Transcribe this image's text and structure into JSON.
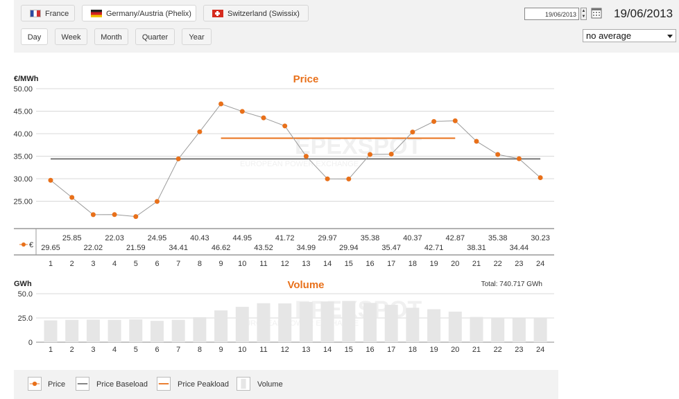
{
  "markets": [
    {
      "label": "France",
      "flag": "france-flag-icon",
      "active": false
    },
    {
      "label": "Germany/Austria (Phelix)",
      "flag": "germany-flag-icon",
      "active": true
    },
    {
      "label": "Switzerland (Swissix)",
      "flag": "switzerland-flag-icon",
      "active": false
    }
  ],
  "periods": [
    {
      "label": "Day",
      "active": true
    },
    {
      "label": "Week",
      "active": false
    },
    {
      "label": "Month",
      "active": false
    },
    {
      "label": "Quarter",
      "active": false
    },
    {
      "label": "Year",
      "active": false
    }
  ],
  "date_input": "19/06/2013",
  "date_display": "19/06/2013",
  "average_select": "no average",
  "watermark": {
    "main": "EPEXSPOT",
    "sub": "EUROPEAN POWER EXCHANGE"
  },
  "colors": {
    "price": "#e8701a",
    "baseload": "#777777",
    "peakload": "#e8701a",
    "volume": "#e6e6e6",
    "title": "#e8701a"
  },
  "chart_data": [
    {
      "type": "line",
      "title": "Price",
      "ylabel": "€/MWh",
      "ylim": [
        20,
        50
      ],
      "yticks": [
        "50.00",
        "45.00",
        "40.00",
        "35.00",
        "30.00",
        "25.00"
      ],
      "x": [
        1,
        2,
        3,
        4,
        5,
        6,
        7,
        8,
        9,
        10,
        11,
        12,
        13,
        14,
        15,
        16,
        17,
        18,
        19,
        20,
        21,
        22,
        23,
        24
      ],
      "series": [
        {
          "name": "€",
          "values": [
            29.65,
            25.85,
            22.02,
            22.03,
            21.59,
            24.95,
            34.41,
            40.43,
            46.62,
            44.95,
            43.52,
            41.72,
            34.99,
            29.97,
            29.94,
            35.38,
            35.47,
            40.37,
            42.71,
            42.87,
            38.31,
            35.38,
            34.44,
            30.23
          ]
        }
      ],
      "baseload": 34.4,
      "peakload": {
        "value": 39.0,
        "from": 9,
        "to": 20
      },
      "table_labels": [
        "29.65",
        "25.85",
        "22.02",
        "22.03",
        "21.59",
        "24.95",
        "34.41",
        "40.43",
        "46.62",
        "44.95",
        "43.52",
        "41.72",
        "34.99",
        "29.97",
        "29.94",
        "35.38",
        "35.47",
        "40.37",
        "42.71",
        "42.87",
        "38.31",
        "35.38",
        "34.44",
        "30.23"
      ]
    },
    {
      "type": "bar",
      "title": "Volume",
      "ylabel": "GWh",
      "ylim": [
        0,
        50
      ],
      "yticks": [
        "50.0",
        "25.0",
        "0"
      ],
      "total": "Total: 740.717 GWh",
      "categories": [
        1,
        2,
        3,
        4,
        5,
        6,
        7,
        8,
        9,
        10,
        11,
        12,
        13,
        14,
        15,
        16,
        17,
        18,
        19,
        20,
        21,
        22,
        23,
        24
      ],
      "values": [
        22.5,
        23.0,
        23.2,
        23.0,
        23.5,
        22.0,
        23.0,
        25.8,
        32.8,
        36.5,
        40.2,
        40.0,
        41.5,
        42.0,
        42.5,
        40.5,
        38.5,
        35.5,
        34.0,
        31.5,
        26.0,
        25.0,
        24.5,
        25.0
      ]
    }
  ],
  "legend": [
    {
      "label": "Price",
      "icon": "price-line-dot-icon"
    },
    {
      "label": "Price Baseload",
      "icon": "baseload-line-icon"
    },
    {
      "label": "Price Peakload",
      "icon": "peakload-line-icon"
    },
    {
      "label": "Volume",
      "icon": "volume-bar-icon"
    }
  ]
}
